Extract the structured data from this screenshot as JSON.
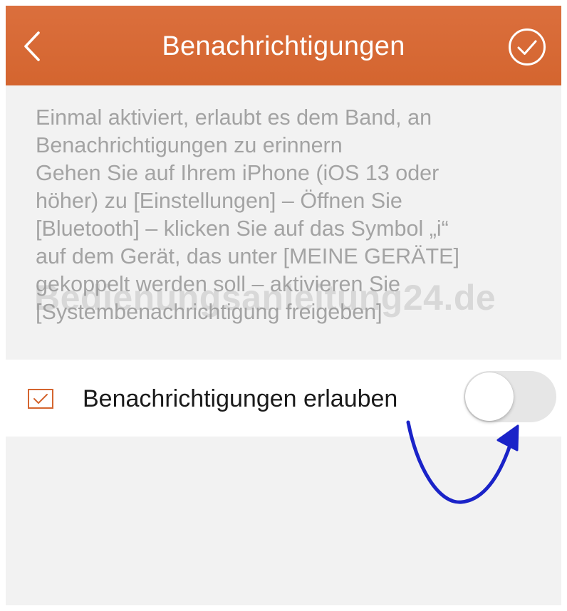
{
  "header": {
    "title": "Benachrichtigungen",
    "back_icon": "chevron-left-icon",
    "confirm_icon": "check-circle-icon"
  },
  "description": {
    "lines": [
      "Einmal aktiviert, erlaubt es dem Band, an",
      "Benachrichtigungen zu erinnern",
      "Gehen Sie auf Ihrem iPhone (iOS 13 oder",
      "höher) zu [Einstellungen] – Öffnen Sie",
      "[Bluetooth] – klicken Sie auf das Symbol „i“",
      "auf dem Gerät, das unter [MEINE GERÄTE]",
      "gekoppelt werden soll – aktivieren Sie",
      "[Systembenachrichtigung freigeben]"
    ]
  },
  "watermark": "Bedienungsanleitung24.de",
  "permission": {
    "label": "Benachrichtigungen erlauben",
    "icon": "checkbox-icon",
    "toggle_on": false
  },
  "annotation": {
    "icon": "arrow-annotation-icon",
    "color": "#1a23c8"
  },
  "colors": {
    "header": "#d86a35",
    "accent": "#d4652f",
    "background": "#f2f2f2",
    "description_text": "#a3a3a3",
    "toggle_off": "#e6e6e6"
  }
}
